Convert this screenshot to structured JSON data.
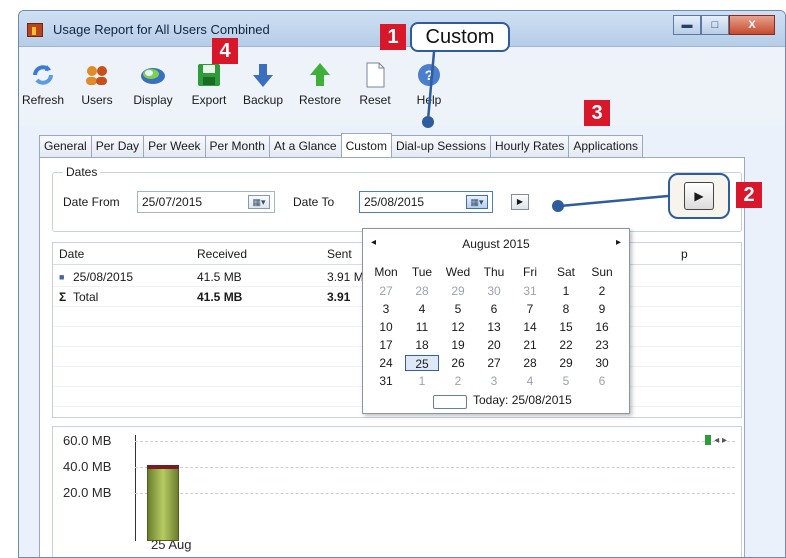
{
  "window": {
    "title": "Usage Report for All Users Combined",
    "buttons": {
      "minimize": "▬",
      "maximize": "□",
      "close": "X"
    }
  },
  "toolbar": {
    "items": [
      {
        "label": "Refresh",
        "icon": "refresh-icon"
      },
      {
        "label": "Users",
        "icon": "users-icon"
      },
      {
        "label": "Display",
        "icon": "display-icon"
      },
      {
        "label": "Export",
        "icon": "save-icon"
      },
      {
        "label": "Backup",
        "icon": "backup-arrow-icon"
      },
      {
        "label": "Restore",
        "icon": "restore-arrow-icon"
      },
      {
        "label": "Reset",
        "icon": "blank-page-icon"
      },
      {
        "label": "Help",
        "icon": "help-icon"
      }
    ]
  },
  "tabs": [
    "General",
    "Per Day",
    "Per Week",
    "Per Month",
    "At a Glance",
    "Custom",
    "Dial-up Sessions",
    "Hourly Rates",
    "Applications"
  ],
  "active_tab": "Custom",
  "dates": {
    "legend": "Dates",
    "from_label": "Date From",
    "from_value": "25/07/2015",
    "to_label": "Date To",
    "to_value": "25/08/2015",
    "go_glyph": "▶"
  },
  "grid": {
    "headers": [
      "Date",
      "Received",
      "Sent",
      "p"
    ],
    "rows": [
      {
        "date": "25/08/2015",
        "received": "41.5 MB",
        "sent": "3.91 M"
      },
      {
        "date": "Total",
        "received": "41.5 MB",
        "sent": "3.91"
      }
    ],
    "total_symbol": "Σ"
  },
  "chart_data": {
    "type": "bar",
    "categories": [
      "25 Aug"
    ],
    "series": [
      {
        "values": [
          45.4
        ]
      }
    ],
    "ytick_labels": [
      "60.0 MB",
      "40.0 MB",
      "20.0 MB"
    ],
    "ylim": [
      0,
      60
    ],
    "colors": {
      "received": "#9ab546",
      "sent": "#7a1a22"
    }
  },
  "calendar": {
    "month": "August 2015",
    "prev": "◂",
    "next": "▸",
    "weekdays": [
      "Mon",
      "Tue",
      "Wed",
      "Thu",
      "Fri",
      "Sat",
      "Sun"
    ],
    "weeks": [
      [
        "27",
        "28",
        "29",
        "30",
        "31",
        "1",
        "2"
      ],
      [
        "3",
        "4",
        "5",
        "6",
        "7",
        "8",
        "9"
      ],
      [
        "10",
        "11",
        "12",
        "13",
        "14",
        "15",
        "16"
      ],
      [
        "17",
        "18",
        "19",
        "20",
        "21",
        "22",
        "23"
      ],
      [
        "24",
        "25",
        "26",
        "27",
        "28",
        "29",
        "30"
      ],
      [
        "31",
        "1",
        "2",
        "3",
        "4",
        "5",
        "6"
      ]
    ],
    "today_label": "Today: 25/08/2015"
  },
  "annotations": {
    "badges": [
      "1",
      "2",
      "3",
      "4"
    ],
    "callout_text": "Custom",
    "accent": "#d8172a",
    "callout_border": "#2f5c9c"
  }
}
